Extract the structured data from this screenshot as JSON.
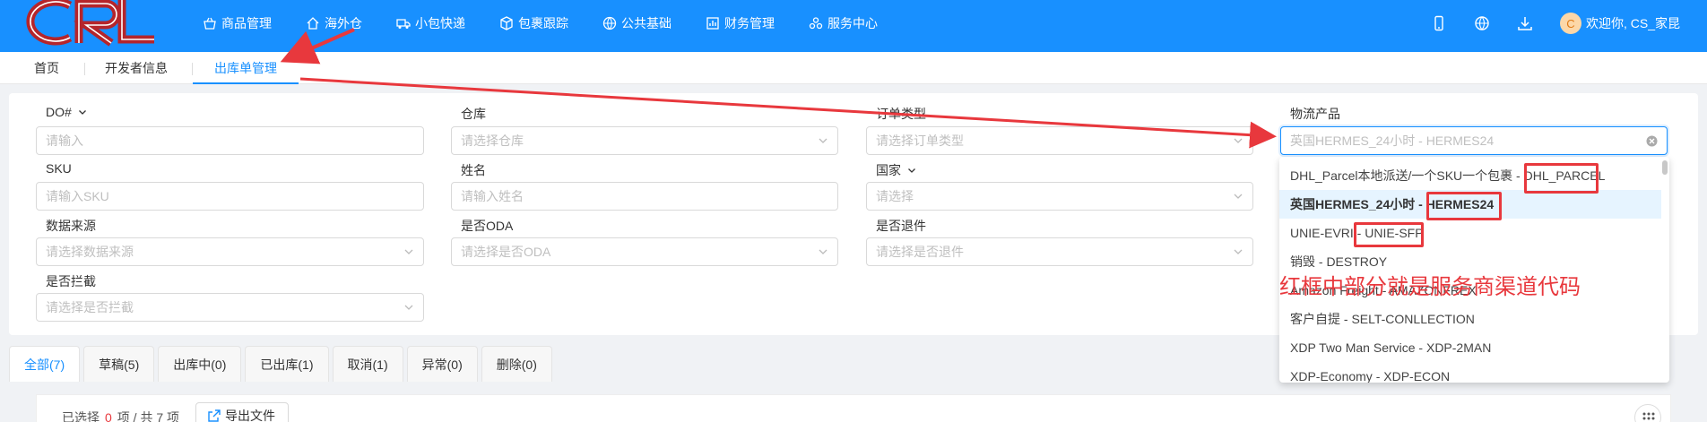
{
  "header": {
    "nav": [
      {
        "label": "商品管理",
        "icon": "basket-icon"
      },
      {
        "label": "海外仓",
        "icon": "home-icon"
      },
      {
        "label": "小包快递",
        "icon": "truck-icon"
      },
      {
        "label": "包裹跟踪",
        "icon": "package-icon"
      },
      {
        "label": "公共基础",
        "icon": "globe-icon"
      },
      {
        "label": "财务管理",
        "icon": "finance-icon"
      },
      {
        "label": "服务中心",
        "icon": "service-icon"
      }
    ],
    "avatar_letter": "C",
    "welcome": "欢迎你, CS_家昆"
  },
  "page_tabs": {
    "home": "首页",
    "developer": "开发者信息",
    "outbound": "出库单管理"
  },
  "filters": {
    "do_label": "DO#",
    "do_placeholder": "请输入",
    "warehouse_label": "仓库",
    "warehouse_placeholder": "请选择仓库",
    "order_type_label": "订单类型",
    "order_type_placeholder": "请选择订单类型",
    "logistics_label": "物流产品",
    "logistics_value": "英国HERMES_24小时 - HERMES24",
    "sku_label": "SKU",
    "sku_placeholder": "请输入SKU",
    "name_label": "姓名",
    "name_placeholder": "请输入姓名",
    "country_label": "国家",
    "country_placeholder": "请选择",
    "source_label": "数据来源",
    "source_placeholder": "请选择数据来源",
    "oda_label": "是否ODA",
    "oda_placeholder": "请选择是否ODA",
    "return_label": "是否退件",
    "return_placeholder": "请选择是否退件",
    "intercept_label": "是否拦截",
    "intercept_placeholder": "请选择是否拦截"
  },
  "dropdown": {
    "items": [
      {
        "label": "DHL_Parcel本地派送/一个SKU一个包裹 - DHL_PARCEL",
        "selected": false
      },
      {
        "label": "英国HERMES_24小时 - HERMES24",
        "selected": true
      },
      {
        "label": "UNIE-EVRI - UNIE-SFP",
        "selected": false
      },
      {
        "label": "销毁 - DESTROY",
        "selected": false
      },
      {
        "label": "Amazon Freight - AMAZONFREX",
        "selected": false
      },
      {
        "label": "客户自提 - SELT-CONLLECTION",
        "selected": false
      },
      {
        "label": "XDP Two Man Service - XDP-2MAN",
        "selected": false
      },
      {
        "label": "XDP-Economy - XDP-ECON",
        "selected": false
      }
    ]
  },
  "annotation": "红框中部分就是服务商渠道代码",
  "status_tabs": [
    "全部(7)",
    "草稿(5)",
    "出库中(0)",
    "已出库(1)",
    "取消(1)",
    "异常(0)",
    "删除(0)"
  ],
  "table": {
    "selected_prefix": "已选择",
    "selected_count": "0",
    "selected_suffix": "项 / 共 7 项",
    "export_label": "导出文件"
  },
  "colors": {
    "primary": "#1890ff",
    "annotation_red": "#e8383d"
  }
}
